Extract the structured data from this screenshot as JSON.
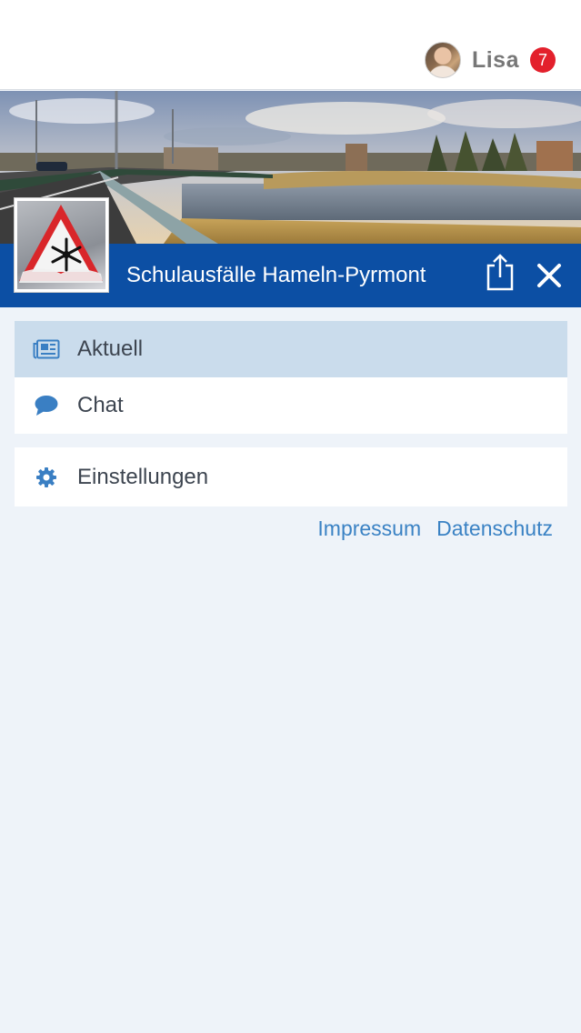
{
  "header": {
    "username": "Lisa",
    "notification_count": "7"
  },
  "banner": {
    "title": "Schulausfälle Hameln-Pyrmont"
  },
  "menu": {
    "items": [
      {
        "label": "Aktuell",
        "icon": "newspaper-icon",
        "active": true
      },
      {
        "label": "Chat",
        "icon": "chat-bubble-icon",
        "active": false
      }
    ],
    "settings": {
      "label": "Einstellungen",
      "icon": "gear-icon"
    }
  },
  "footer_links": {
    "impressum": "Impressum",
    "datenschutz": "Datenschutz"
  },
  "colors": {
    "title_bar": "#0c4fa4",
    "active_item": "#cadcec",
    "link": "#3a82c4",
    "badge": "#e3202c",
    "page_background": "#eef3f9"
  }
}
